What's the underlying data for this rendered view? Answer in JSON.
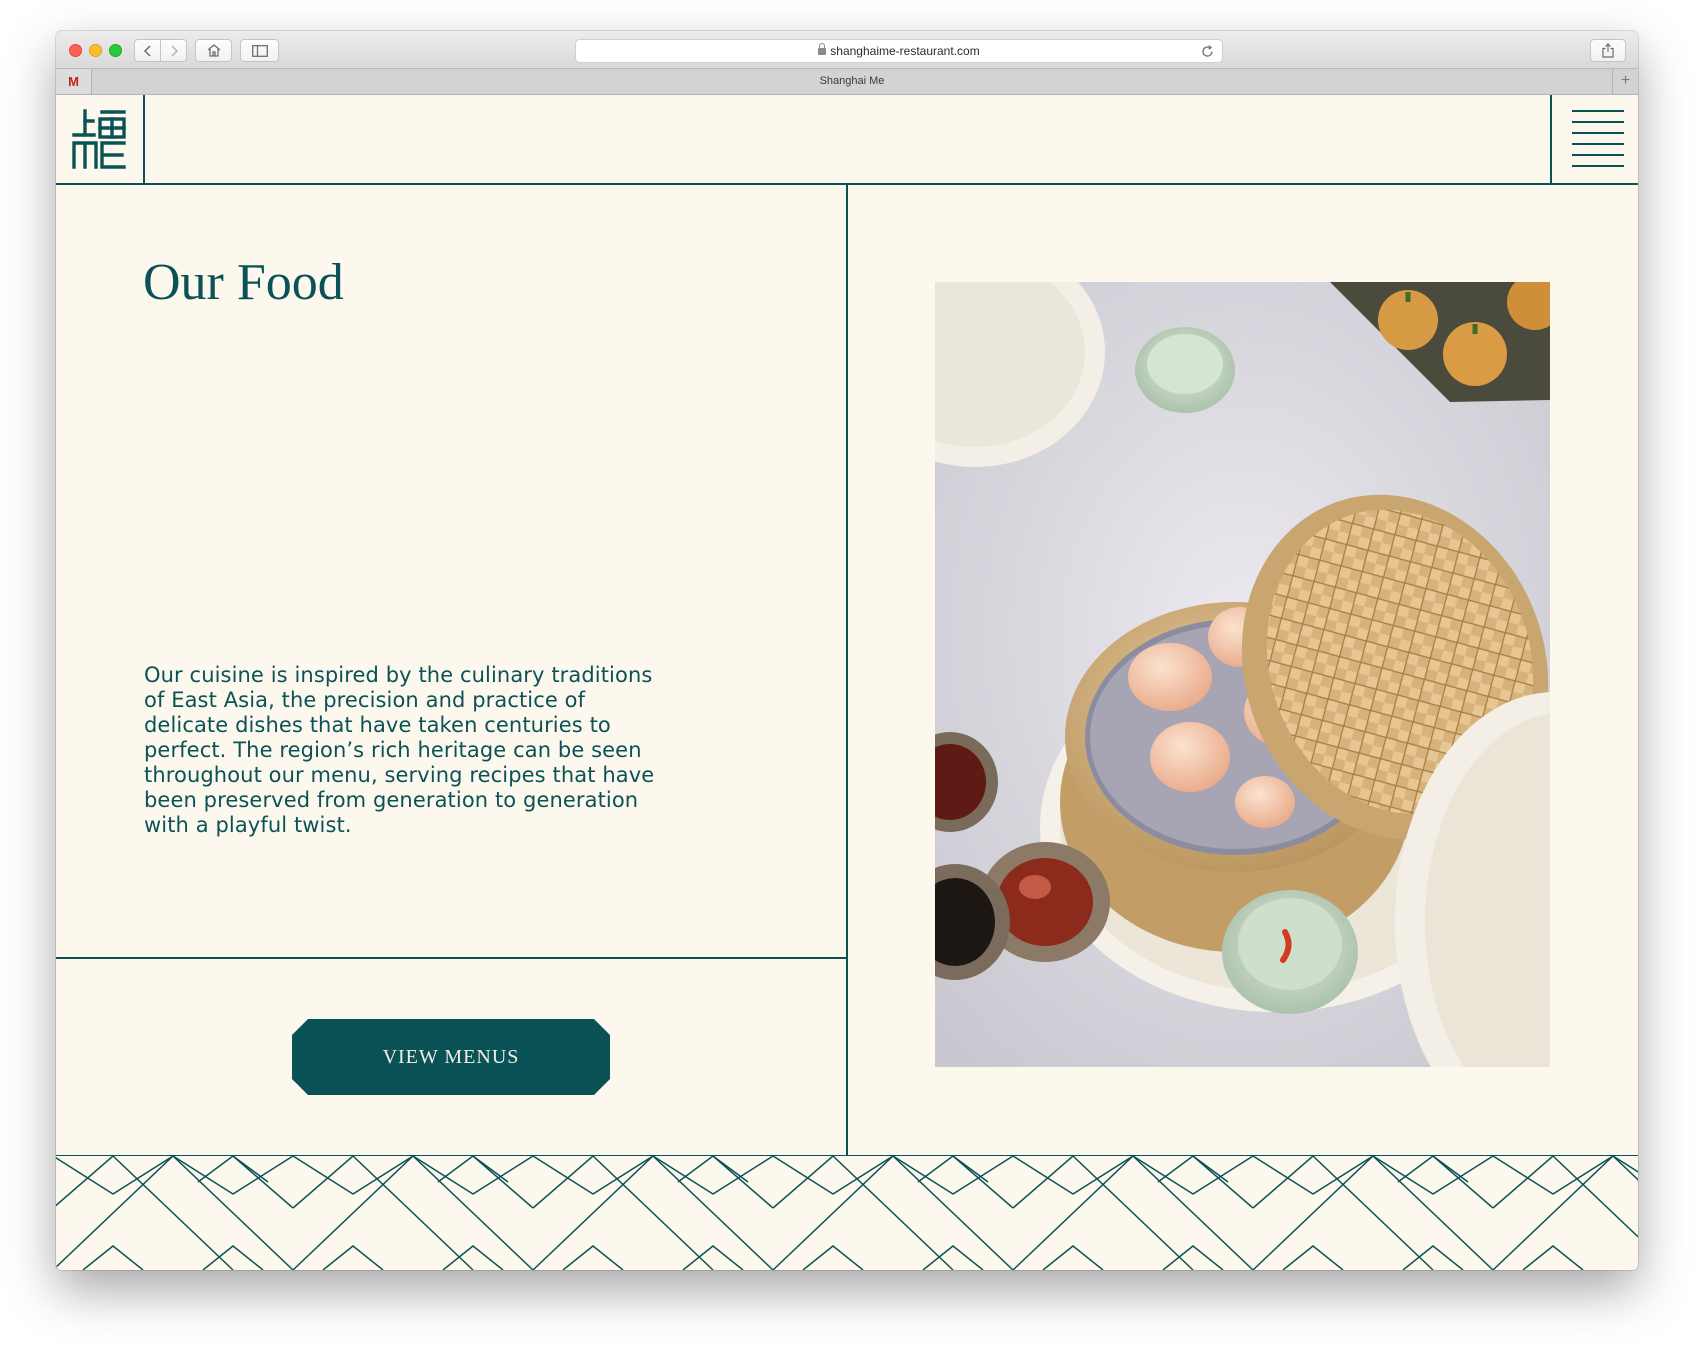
{
  "browser": {
    "url": "shanghaime-restaurant.com",
    "tab_title": "Shanghai Me",
    "tab_favicon": "M",
    "icons": {
      "back": "chevron-left-icon",
      "forward": "chevron-right-icon",
      "home": "home-icon",
      "sidebar": "sidebar-icon",
      "share": "share-icon",
      "reload": "reload-icon",
      "new_tab": "plus-icon"
    }
  },
  "header": {
    "logo_icon": "shanghai-me-logo-icon",
    "menu_icon": "hamburger-menu-icon"
  },
  "main": {
    "title": "Our Food",
    "description": "Our cuisine is inspired by the culinary traditions of East Asia, the precision and practice of delicate dishes that have taken centuries to perfect. The region’s rich heritage can be seen throughout our menu, serving recipes that have been preserved from generation to generation with a playful twist.",
    "cta_label": "VIEW MENUS"
  },
  "colors": {
    "brand_teal": "#0b5257",
    "background_cream": "#fdf8ee"
  }
}
